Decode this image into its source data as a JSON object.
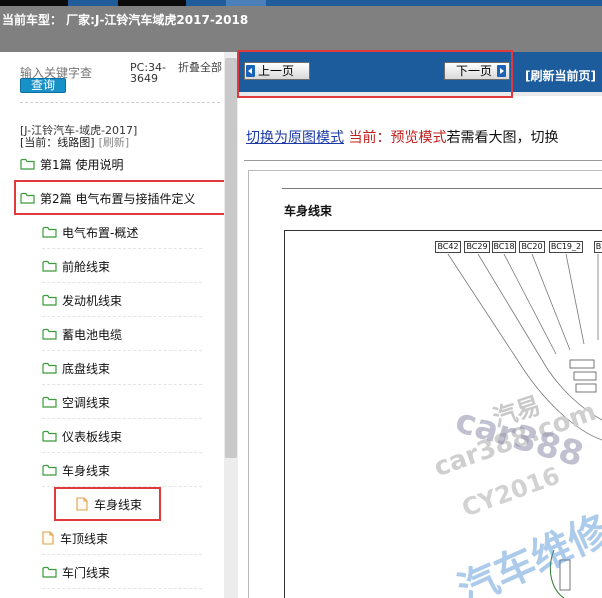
{
  "header": {
    "car_model": "当前车型： 厂家:J-江铃汽车域虎2017-2018"
  },
  "sidebar": {
    "search_placeholder": "输入关键字查",
    "search_button": "查询",
    "pc_code": "PC:34-3649",
    "fold_all": "折叠全部",
    "car_name": "[J-江铃汽车-域虎-2017]",
    "current_label": "[当前：线路图]",
    "refresh_label": "[刷新]",
    "tree": [
      {
        "label": "第1篇 使用说明",
        "type": "folder"
      },
      {
        "label": "第2篇 电气布置与接插件定义",
        "type": "folder"
      },
      {
        "label": "电气布置-概述",
        "type": "folder"
      },
      {
        "label": "前舱线束",
        "type": "folder"
      },
      {
        "label": "发动机线束",
        "type": "folder"
      },
      {
        "label": "蓄电池电缆",
        "type": "folder"
      },
      {
        "label": "底盘线束",
        "type": "folder"
      },
      {
        "label": "空调线束",
        "type": "folder"
      },
      {
        "label": "仪表板线束",
        "type": "folder"
      },
      {
        "label": "车身线束",
        "type": "folder"
      },
      {
        "label": "车身线束",
        "type": "doc"
      },
      {
        "label": "车顶线束",
        "type": "doc"
      },
      {
        "label": "车门线束",
        "type": "folder"
      }
    ]
  },
  "toolbar": {
    "prev_label": "上一页",
    "next_label": "下一页",
    "refresh_page": "[刷新当前页]"
  },
  "content": {
    "mode_link": "切换为原图模式",
    "mode_current": "当前：预览模式",
    "mode_hint": "若需看大图，切换",
    "diagram_title": "车身线束",
    "connectors": [
      "BC42",
      "BC29",
      "BC18",
      "BC20",
      "BC19_2",
      "B"
    ],
    "watermarks": [
      "汽易",
      "car388.com",
      "car388",
      "CY2016",
      "汽车维修"
    ]
  },
  "colors": {
    "nav_blue": "#1c5b9c",
    "highlight_red": "#e03a3e",
    "link_blue": "#1b3aa6",
    "current_red": "#c0201f",
    "folder_green": "#3a9b3a",
    "doc_orange": "#e0a04a"
  }
}
